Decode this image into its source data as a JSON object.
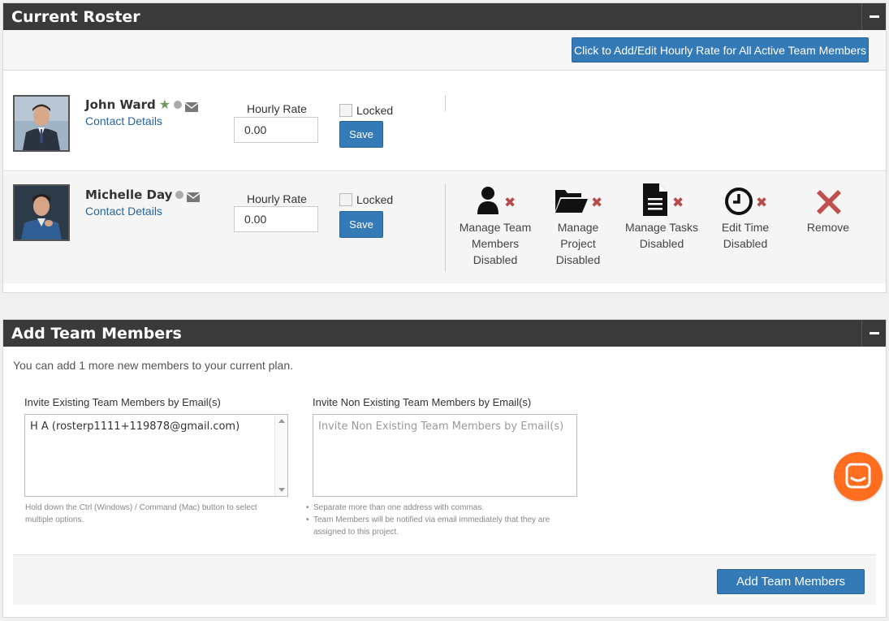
{
  "roster": {
    "title": "Current Roster",
    "rate_all_button": "Click to Add/Edit Hourly Rate for All Active Team Members",
    "members": [
      {
        "name": "John Ward",
        "contact_link": "Contact Details",
        "hourly_rate_label": "Hourly Rate",
        "hourly_rate_value": "0.00",
        "locked_label": "Locked",
        "save_label": "Save",
        "icons": [
          "star-icon",
          "status-dot-icon",
          "envelope-icon"
        ]
      },
      {
        "name": "Michelle Day",
        "contact_link": "Contact Details",
        "hourly_rate_label": "Hourly Rate",
        "hourly_rate_value": "0.00",
        "locked_label": "Locked",
        "save_label": "Save",
        "icons": [
          "status-dot-icon",
          "envelope-icon"
        ],
        "permissions": [
          {
            "icon": "user-icon",
            "line1": "Manage Team",
            "line2": "Members",
            "line3": "Disabled"
          },
          {
            "icon": "folder-open-icon",
            "line1": "Manage",
            "line2": "Project",
            "line3": "Disabled"
          },
          {
            "icon": "document-icon",
            "line1": "Manage Tasks",
            "line2": "Disabled"
          },
          {
            "icon": "clock-icon",
            "line1": "Edit Time",
            "line2": "Disabled"
          },
          {
            "icon": "remove-icon",
            "line1": "Remove"
          }
        ]
      }
    ]
  },
  "add_members": {
    "title": "Add Team Members",
    "intro": "You can add 1 more new members to your current plan.",
    "existing_label": "Invite Existing Team Members by Email(s)",
    "existing_value": "H A (rosterp1111+119878@gmail.com)",
    "existing_help_1": "Hold down the Ctrl (Windows) / Command (Mac) button to select",
    "existing_help_2": "multiple options.",
    "nonexisting_label": "Invite Non Existing Team Members by Email(s)",
    "nonexisting_placeholder": "Invite Non Existing Team Members by Email(s)",
    "help_bullets": [
      "Separate more than one address with commas.",
      "Team Members will be notified via email immediately that they are",
      "assigned to this project."
    ],
    "add_button": "Add Team Members"
  },
  "colors": {
    "header_bg": "#3a3a3a",
    "primary_button": "#337ab7",
    "link": "#2a6496",
    "disabled_x": "#b94a48",
    "star": "#6b9a5e",
    "chat_button": "#ff6d1f"
  }
}
